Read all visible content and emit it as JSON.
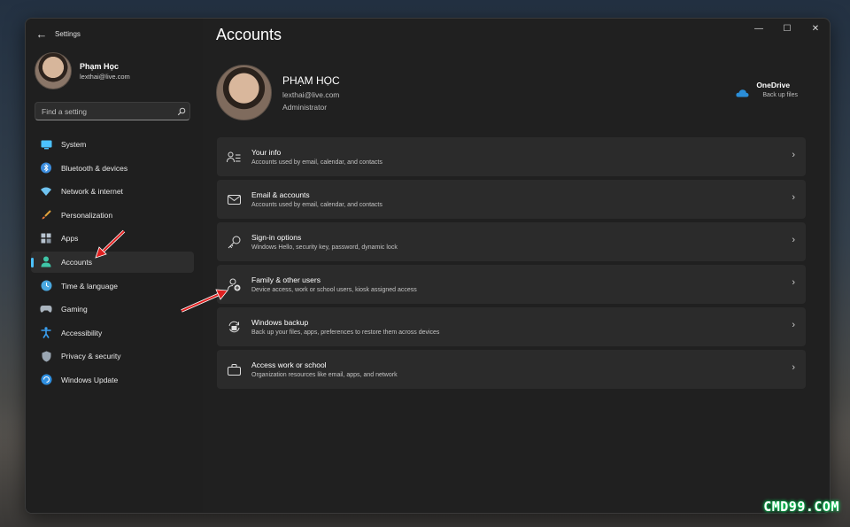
{
  "window": {
    "app_title": "Settings",
    "back_glyph": "←",
    "minimize_glyph": "—",
    "maximize_glyph": "☐",
    "close_glyph": "✕"
  },
  "sidebar": {
    "profile": {
      "name": "Phạm Học",
      "email": "lexthai@live.com"
    },
    "search": {
      "placeholder": "Find a setting"
    },
    "items": [
      {
        "label": "System",
        "icon": "monitor-icon"
      },
      {
        "label": "Bluetooth & devices",
        "icon": "bluetooth-icon"
      },
      {
        "label": "Network & internet",
        "icon": "wifi-icon"
      },
      {
        "label": "Personalization",
        "icon": "brush-icon"
      },
      {
        "label": "Apps",
        "icon": "apps-icon"
      },
      {
        "label": "Accounts",
        "icon": "person-icon",
        "active": true
      },
      {
        "label": "Time & language",
        "icon": "clock-globe-icon"
      },
      {
        "label": "Gaming",
        "icon": "gamepad-icon"
      },
      {
        "label": "Accessibility",
        "icon": "accessibility-icon"
      },
      {
        "label": "Privacy & security",
        "icon": "shield-icon"
      },
      {
        "label": "Windows Update",
        "icon": "update-icon"
      }
    ]
  },
  "main": {
    "page_title": "Accounts",
    "user": {
      "name": "PHẠM HỌC",
      "email": "lexthai@live.com",
      "role": "Administrator"
    },
    "onedrive": {
      "name": "OneDrive",
      "status": "Back up files"
    },
    "cards": [
      {
        "title": "Your info",
        "subtitle": "Accounts used by email, calendar, and contacts",
        "icon": "person-list-icon"
      },
      {
        "title": "Email & accounts",
        "subtitle": "Accounts used by email, calendar, and contacts",
        "icon": "mail-icon"
      },
      {
        "title": "Sign-in options",
        "subtitle": "Windows Hello, security key, password, dynamic lock",
        "icon": "key-icon"
      },
      {
        "title": "Family & other users",
        "subtitle": "Device access, work or school users, kiosk assigned access",
        "icon": "person-add-icon"
      },
      {
        "title": "Windows backup",
        "subtitle": "Back up your files, apps, preferences to restore them across devices",
        "icon": "backup-icon"
      },
      {
        "title": "Access work or school",
        "subtitle": "Organization resources like email, apps, and network",
        "icon": "briefcase-icon"
      }
    ],
    "chevron": "›"
  },
  "colors": {
    "accent": "#4cc2ff",
    "window_bg": "#202020",
    "card_bg": "#2b2b2b",
    "annotation_arrow": "#e02020"
  },
  "watermark": "CMD99.COM"
}
